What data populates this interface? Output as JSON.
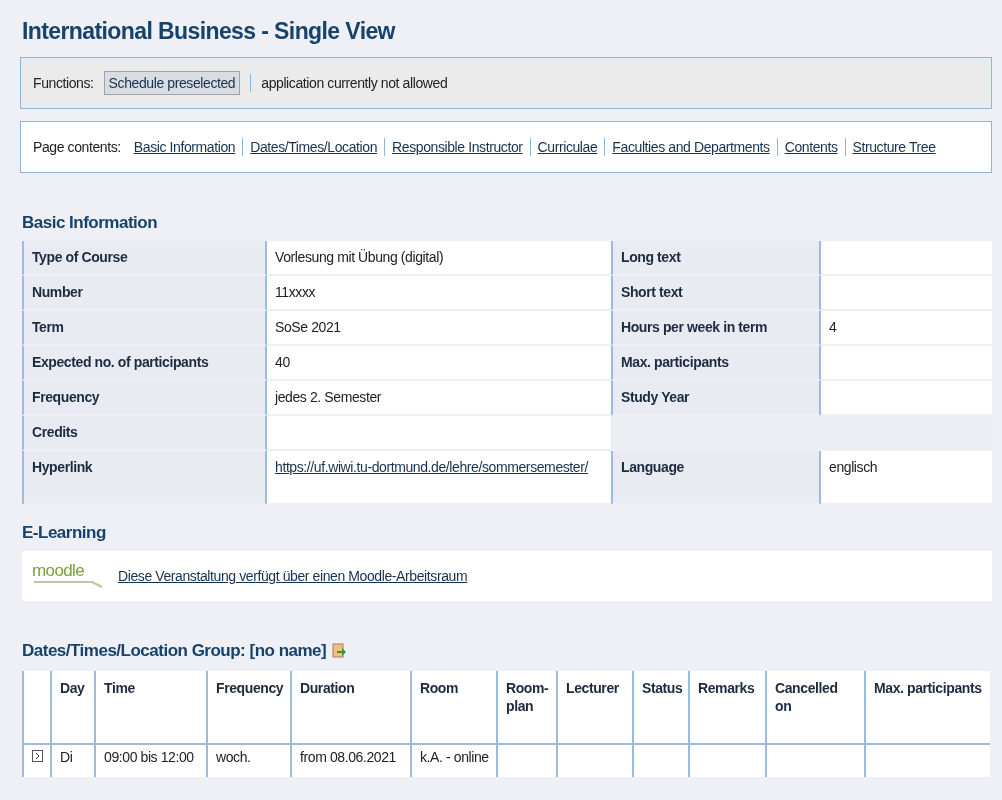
{
  "title": "International Business - Single View",
  "functions": {
    "label": "Functions:",
    "button": "Schedule preselected",
    "note": "application currently not allowed"
  },
  "page_contents": {
    "label": "Page contents:",
    "links": [
      "Basic Information",
      "Dates/Times/Location",
      "Responsible Instructor",
      "Curriculae",
      "Faculties and Departments",
      "Contents",
      "Structure Tree"
    ]
  },
  "basic_information": {
    "heading": "Basic Information",
    "rows": [
      {
        "label": "Type of Course",
        "value": "Vorlesung mit Übung (digital)",
        "label_2": "Long text",
        "value_2": ""
      },
      {
        "label": "Number",
        "value": "11xxxx",
        "label_2": "Short text",
        "value_2": ""
      },
      {
        "label": "Term",
        "value": "SoSe 2021",
        "label_2": "Hours per week in term",
        "value_2": "4"
      },
      {
        "label": "Expected no. of participants",
        "value": "40",
        "label_2": "Max. participants",
        "value_2": ""
      },
      {
        "label": "Frequency",
        "value": "jedes 2. Semester",
        "label_2": "Study Year",
        "value_2": ""
      },
      {
        "label": "Credits",
        "value": ""
      },
      {
        "label": "Hyperlink",
        "link": "https://uf.wiwi.tu-dortmund.de/lehre/sommersemester/",
        "label_2": "Language",
        "value_2": "englisch"
      }
    ]
  },
  "e_learning": {
    "heading": "E-Learning",
    "logo_text": "moodle",
    "link": "Diese Veranstaltung verfügt über einen Moodle-Arbeitsraum"
  },
  "dates": {
    "heading": "Dates/Times/Location Group: [no name]",
    "columns": [
      "Day",
      "Time",
      "Frequency",
      "Duration",
      "Room",
      "Room-plan",
      "Lecturer",
      "Status",
      "Remarks",
      "Cancelled on",
      "Max. participants"
    ],
    "rows": [
      {
        "cells": [
          "Di",
          "09:00 bis 12:00",
          "woch.",
          "from 08.06.2021",
          "k.A. - online",
          "",
          "",
          "",
          "",
          "",
          ""
        ]
      }
    ]
  }
}
